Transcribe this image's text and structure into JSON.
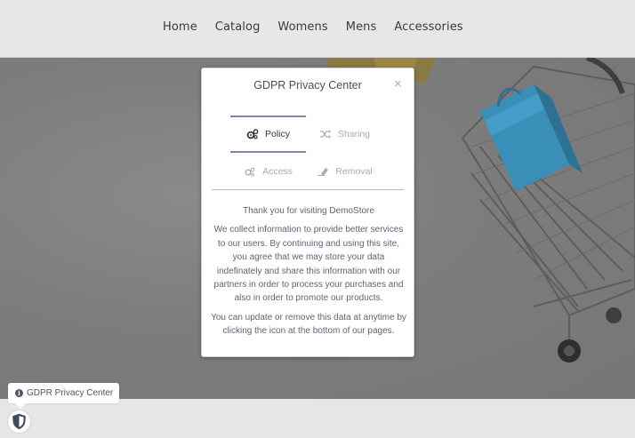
{
  "nav": {
    "items": [
      {
        "label": "Home"
      },
      {
        "label": "Catalog"
      },
      {
        "label": "Womens"
      },
      {
        "label": "Mens"
      },
      {
        "label": "Accessories"
      }
    ]
  },
  "modal": {
    "title": "GDPR Privacy Center",
    "close": "×",
    "tabs": [
      {
        "label": "Policy",
        "icon": "cogs-icon",
        "active": true
      },
      {
        "label": "Sharing",
        "icon": "shuffle-icon",
        "active": false
      },
      {
        "label": "Access",
        "icon": "cogs-small-icon",
        "active": false
      },
      {
        "label": "Removal",
        "icon": "eraser-icon",
        "active": false
      }
    ],
    "body": {
      "heading": "Thank you for visiting DemoStore",
      "paragraph1": "We collect information to provide better services to our users. By continuing and using this site, you agree that we may store your data indefinately and share this information with our partners in order to process your purchases and also in order to promote our products.",
      "paragraph2": "You can update or remove this data at anytime by clicking the icon at the bottom of our pages."
    }
  },
  "tooltip": {
    "label": "GDPR Privacy Center",
    "icon": "info-icon"
  },
  "shield": {
    "icon": "shield-icon"
  },
  "colors": {
    "accent": "#7b8aa3",
    "text": "#44505e",
    "muted": "#a6acb5",
    "hero_bg": "#7f7f7f",
    "cart_blue": "#3a8fb8"
  }
}
